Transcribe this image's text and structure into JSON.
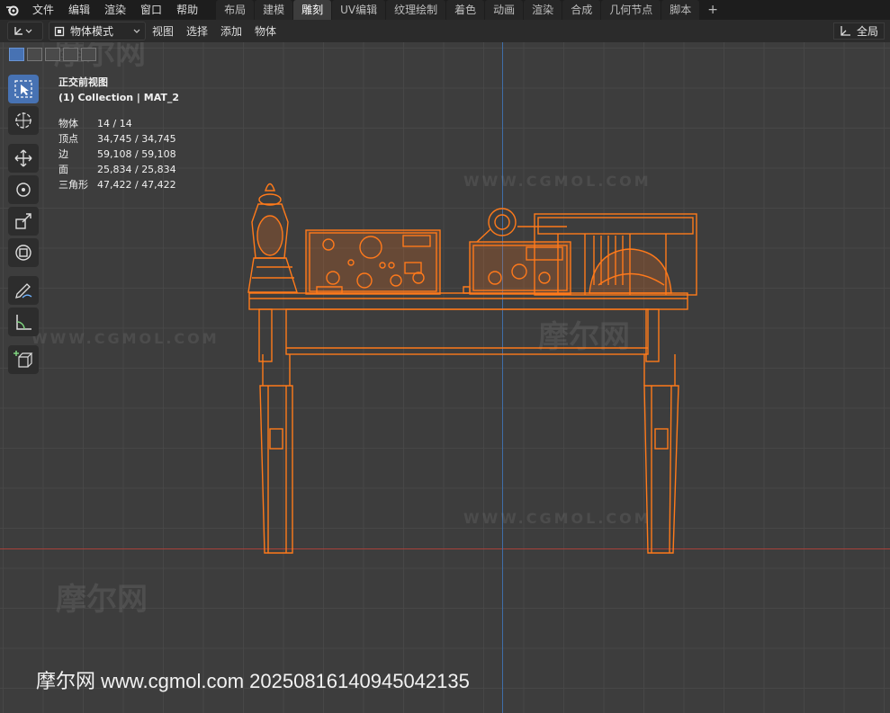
{
  "menu": {
    "file": "文件",
    "edit": "编辑",
    "render": "渲染",
    "window": "窗口",
    "help": "帮助"
  },
  "workspaces": [
    "布局",
    "建模",
    "雕刻",
    "UV编辑",
    "纹理绘制",
    "着色",
    "动画",
    "渲染",
    "合成",
    "几何节点",
    "脚本"
  ],
  "workspace_active": "雕刻",
  "add_tab": "+",
  "header": {
    "mode": "物体模式",
    "view": "视图",
    "select": "选择",
    "add": "添加",
    "object": "物体",
    "global": "全局"
  },
  "overlay": {
    "view_name": "正交前视图",
    "collection": "(1) Collection | MAT_2",
    "stats": [
      {
        "label": "物体",
        "value": "14 / 14"
      },
      {
        "label": "顶点",
        "value": "34,745 / 34,745"
      },
      {
        "label": "边",
        "value": "59,108 / 59,108"
      },
      {
        "label": "面",
        "value": "25,834 / 25,834"
      },
      {
        "label": "三角形",
        "value": "47,422 / 47,422"
      }
    ]
  },
  "tools": [
    "select-box-icon",
    "cursor-icon",
    "move-icon",
    "rotate-icon",
    "scale-icon",
    "transform-icon",
    "annotate-icon",
    "measure-icon",
    "add-cube-icon"
  ],
  "watermark": {
    "site": "WWW.CGMOL.COM",
    "logo": "摩尔网",
    "logo_sub": "WWW.CGMOL.COM"
  },
  "bottom_watermark": "摩尔网 www.cgmol.com 20250816140945042135",
  "colors": {
    "accent": "#4772b3",
    "selection": "#ff7a1a",
    "axis_x": "#a8413a",
    "axis_z": "#3f6ea8",
    "bg": "#3d3d3d"
  }
}
